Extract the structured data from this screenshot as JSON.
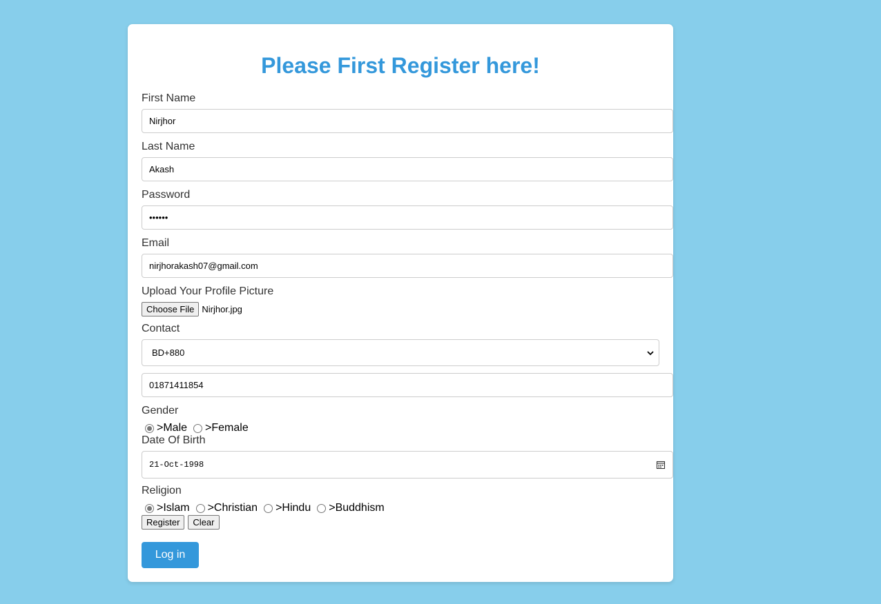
{
  "form": {
    "title": "Please First Register here!",
    "first_name": {
      "label": "First Name",
      "value": "Nirjhor"
    },
    "last_name": {
      "label": "Last Name",
      "value": "Akash"
    },
    "password": {
      "label": "Password",
      "value": "••••••"
    },
    "email": {
      "label": "Email",
      "value": "nirjhorakash07@gmail.com"
    },
    "profile_picture": {
      "label": "Upload Your Profile Picture",
      "button_label": "Choose File",
      "file_name": "Nirjhor.jpg"
    },
    "contact": {
      "label": "Contact",
      "country_code": "BD+880",
      "phone": "01871411854"
    },
    "gender": {
      "label": "Gender",
      "options": [
        {
          "label": ">Male",
          "checked": true
        },
        {
          "label": ">Female",
          "checked": false
        }
      ]
    },
    "dob": {
      "label": "Date Of Birth",
      "value": "21-Oct-1998"
    },
    "religion": {
      "label": "Religion",
      "options": [
        {
          "label": ">Islam",
          "checked": true
        },
        {
          "label": ">Christian",
          "checked": false
        },
        {
          "label": ">Hindu",
          "checked": false
        },
        {
          "label": ">Buddhism",
          "checked": false
        }
      ]
    },
    "register_label": "Register",
    "clear_label": "Clear",
    "login_label": "Log in"
  },
  "colors": {
    "background": "#87ceeb",
    "accent": "#3498db",
    "card": "#ffffff"
  },
  "icons": {
    "select_arrow": "chevron-down-icon",
    "date_picker": "calendar-icon"
  }
}
